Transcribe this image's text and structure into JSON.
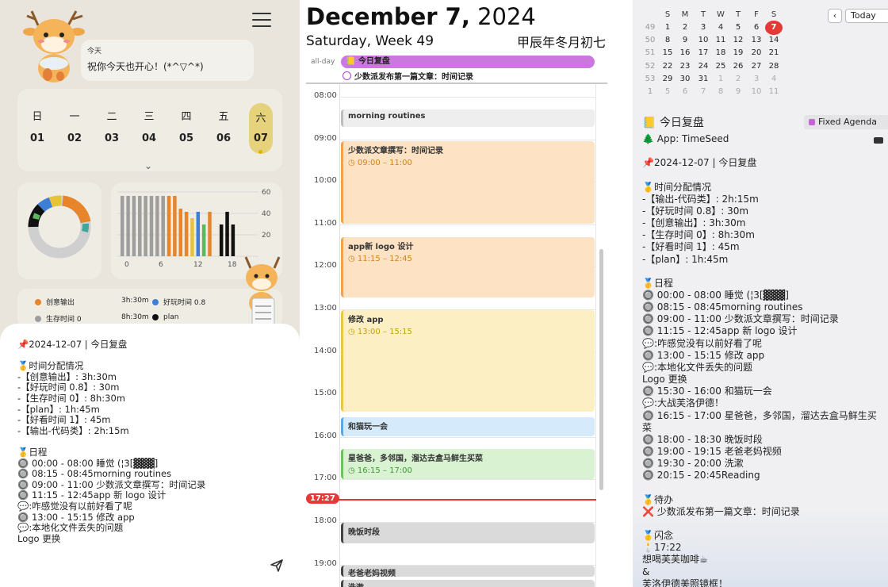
{
  "left": {
    "greeting": {
      "title": "今天",
      "message": "祝你今天也开心！(*^▽^*)"
    },
    "week": {
      "days": [
        {
          "name": "日",
          "date": "01"
        },
        {
          "name": "一",
          "date": "02"
        },
        {
          "name": "二",
          "date": "03"
        },
        {
          "name": "三",
          "date": "04"
        },
        {
          "name": "四",
          "date": "05"
        },
        {
          "name": "五",
          "date": "06"
        },
        {
          "name": "六",
          "date": "07"
        }
      ],
      "selected_index": 6
    },
    "bar_chart": {
      "y_ticks": [
        "60",
        "40",
        "20"
      ],
      "x_ticks": [
        "0",
        "6",
        "12",
        "18"
      ]
    },
    "legend": [
      {
        "label": "创意输出",
        "value": "3h:30m",
        "color": "#e8842a"
      },
      {
        "label": "好玩时间 0.8",
        "value": "",
        "color": "#3b7fd6"
      },
      {
        "label": "生存时间 0",
        "value": "8h:30m",
        "color": "#9e9e9e"
      },
      {
        "label": "plan",
        "value": "",
        "color": "#111111"
      }
    ],
    "note_lines": [
      "📌2024-12-07 | 今日复盘",
      "",
      "🥇时间分配情况",
      "-【创意输出】: 3h:30m",
      "-【好玩时间 0.8】: 30m",
      "-【生存时间 0】: 8h:30m",
      "-【plan】: 1h:45m",
      "-【好看时间 1】: 45m",
      "-【输出-代码类】: 2h:15m",
      "",
      "🥇日程",
      "🔘 00:00 - 08:00 睡觉 (¦3[▓▓▓]",
      "🔘 08:15 - 08:45morning routines",
      "🔘 09:00 - 11:00 少数派文章撰写：时间记录",
      "🔘 11:15 - 12:45app 新 logo 设计",
      "💬:咋感觉没有以前好看了呢",
      "🔘 13:00 - 15:15 修改 app",
      "💬:本地化文件丢失的问题",
      "Logo 更换"
    ]
  },
  "center": {
    "date_bold": "December 7,",
    "year": "2024",
    "weekday_line": "Saturday, Week 49",
    "lunar": "甲辰年冬月初七",
    "allday_label": "all-day",
    "allday_events": [
      "📒 今日复盘",
      "少数派发布第一篇文章：时间记录"
    ],
    "hours": [
      "08:00",
      "09:00",
      "10:00",
      "11:00",
      "12:00",
      "13:00",
      "14:00",
      "15:00",
      "16:00",
      "17:00",
      "18:00",
      "19:00"
    ],
    "now": "17:27",
    "events": [
      {
        "title": "morning routines",
        "time": ""
      },
      {
        "title": "少数派文章撰写：时间记录",
        "time": "◷ 09:00 – 11:00"
      },
      {
        "title": "app新 logo 设计",
        "time": "◷ 11:15 – 12:45"
      },
      {
        "title": "修改 app",
        "time": "◷ 13:00 – 15:15"
      },
      {
        "title": "和猫玩一会",
        "time": ""
      },
      {
        "title": "星爸爸，多邻国，溜达去盒马鲜生买菜",
        "time": "◷ 16:15 – 17:00"
      },
      {
        "title": "晚饭时段",
        "time": ""
      },
      {
        "title": "老爸老妈视频",
        "time": ""
      },
      {
        "title": "洗漱",
        "time": ""
      }
    ]
  },
  "right": {
    "mini_cal": {
      "headers": [
        "S",
        "M",
        "T",
        "W",
        "T",
        "F",
        "S"
      ],
      "weeks": [
        "49",
        "50",
        "51",
        "52",
        "53",
        "1"
      ],
      "rows": [
        [
          "1",
          "2",
          "3",
          "4",
          "5",
          "6",
          "7"
        ],
        [
          "8",
          "9",
          "10",
          "11",
          "12",
          "13",
          "14"
        ],
        [
          "15",
          "16",
          "17",
          "18",
          "19",
          "20",
          "21"
        ],
        [
          "22",
          "23",
          "24",
          "25",
          "26",
          "27",
          "28"
        ],
        [
          "29",
          "30",
          "31",
          "1",
          "2",
          "3",
          "4"
        ],
        [
          "5",
          "6",
          "7",
          "8",
          "9",
          "10",
          "11"
        ]
      ],
      "today_label": "Today"
    },
    "agenda_title": "📒 今日复盘",
    "agenda_tag": "Fixed Agenda",
    "body_lines": [
      "🌲 App: TimeSeed",
      "",
      "📌2024-12-07 | 今日复盘",
      "",
      "🥇时间分配情况",
      "-【输出-代码类】: 2h:15m",
      "-【好玩时间 0.8】: 30m",
      "-【创意输出】: 3h:30m",
      "-【生存时间 0】: 8h:30m",
      "-【好看时间 1】: 45m",
      "-【plan】: 1h:45m",
      "",
      "🥇日程",
      "🔘 00:00 - 08:00 睡觉 (¦3[▓▓▓]",
      "🔘 08:15 - 08:45morning routines",
      "🔘 09:00 - 11:00 少数派文章撰写：时间记录",
      "🔘 11:15 - 12:45app 新 logo 设计",
      "💬:咋感觉没有以前好看了呢",
      "🔘 13:00 - 15:15 修改 app",
      "💬:本地化文件丢失的问题",
      "Logo 更换",
      "🔘 15:30 - 16:00 和猫玩一会",
      "💬:大战芙洛伊德！",
      "🔘 16:15 - 17:00 星爸爸，多邻国，溜达去盒马鲜生买菜",
      "🔘 18:00 - 18:30 晚饭时段",
      "🔘 19:00 - 19:15 老爸老妈视频",
      "🔘 19:30 - 20:00 洗漱",
      "🔘 20:15 - 20:45Reading",
      "",
      "🥇待办",
      "❌ 少数派发布第一篇文章：时间记录",
      "",
      "🥇闪念",
      "🕯️17:22",
      "想喝芙芙咖啡☕",
      "&",
      "芙洛伊德美照镜框！"
    ]
  }
}
